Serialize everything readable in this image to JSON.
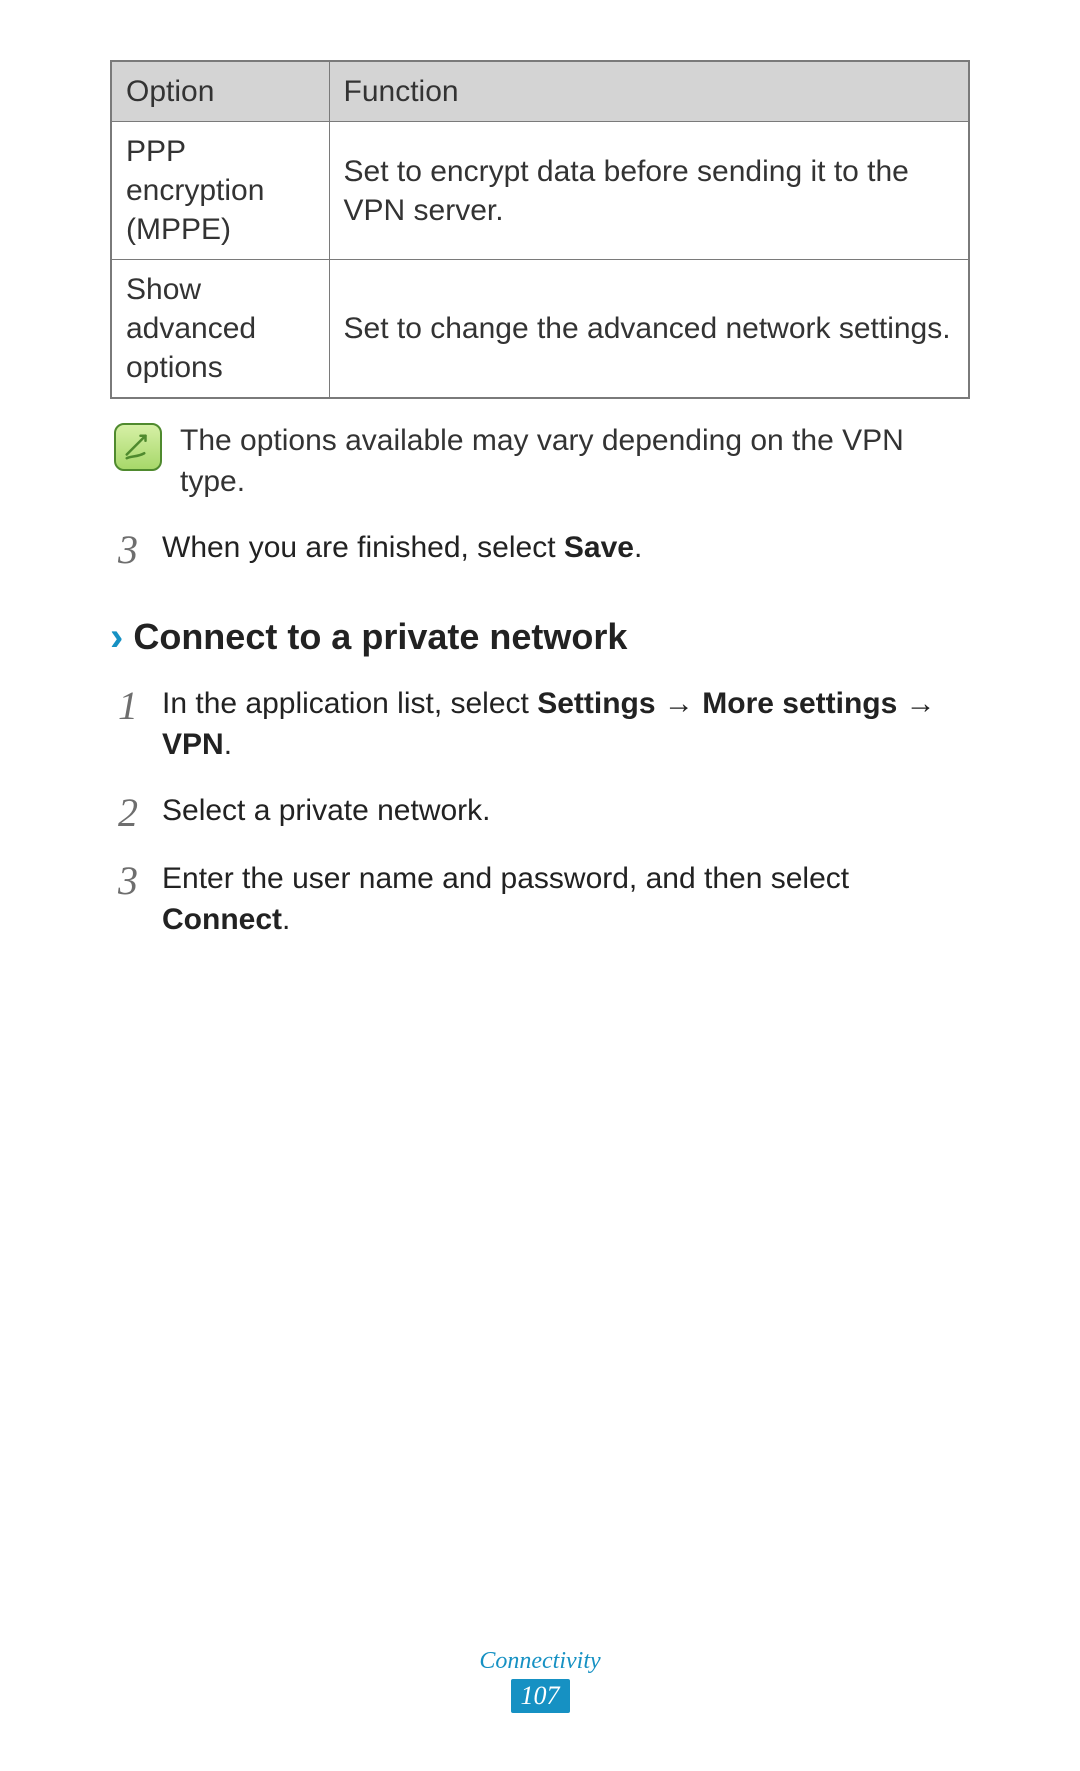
{
  "table": {
    "headers": {
      "option": "Option",
      "function": "Function"
    },
    "rows": [
      {
        "option": "PPP encryption (MPPE)",
        "function": "Set to encrypt data before sending it to the VPN server."
      },
      {
        "option": "Show advanced options",
        "function": "Set to change the advanced network settings."
      }
    ]
  },
  "note": "The options available may vary depending on the VPN type.",
  "step_after_table": {
    "num": "3",
    "text_before": "When you are finished, select ",
    "bold": "Save",
    "text_after": "."
  },
  "section": {
    "chevron": "›",
    "title": "Connect to a private network"
  },
  "steps": [
    {
      "num": "1",
      "parts": [
        {
          "t": "In the application list, select "
        },
        {
          "t": "Settings",
          "b": true
        },
        {
          "t": " → "
        },
        {
          "t": "More settings",
          "b": true
        },
        {
          "t": " → "
        },
        {
          "t": "VPN",
          "b": true
        },
        {
          "t": "."
        }
      ]
    },
    {
      "num": "2",
      "parts": [
        {
          "t": "Select a private network."
        }
      ]
    },
    {
      "num": "3",
      "parts": [
        {
          "t": "Enter the user name and password, and then select "
        },
        {
          "t": "Connect",
          "b": true
        },
        {
          "t": "."
        }
      ]
    }
  ],
  "footer": {
    "label": "Connectivity",
    "page": "107"
  }
}
